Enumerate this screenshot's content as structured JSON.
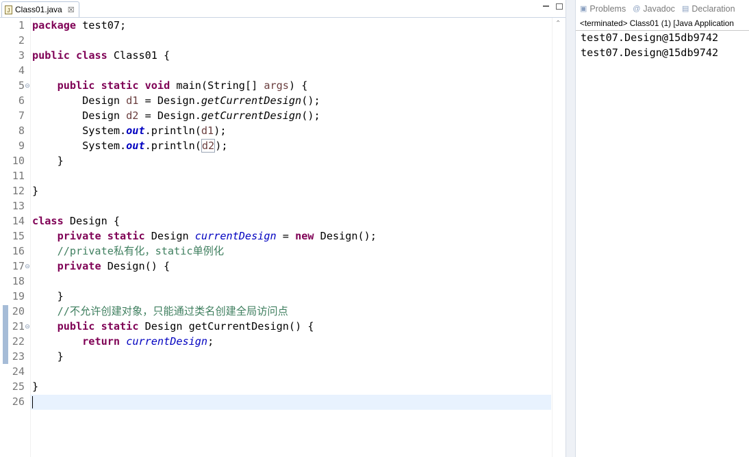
{
  "editor": {
    "tab_title": "Class01.java",
    "tab_close": "☒"
  },
  "lines": [
    {
      "n": "1",
      "tokens": [
        {
          "t": "package",
          "c": "kw"
        },
        {
          "t": " test07;"
        }
      ]
    },
    {
      "n": "2",
      "tokens": []
    },
    {
      "n": "3",
      "tokens": [
        {
          "t": "public",
          "c": "kw"
        },
        {
          "t": " "
        },
        {
          "t": "class",
          "c": "kw"
        },
        {
          "t": " Class01 {"
        }
      ]
    },
    {
      "n": "4",
      "tokens": []
    },
    {
      "n": "5",
      "fold": true,
      "tokens": [
        {
          "t": "    "
        },
        {
          "t": "public",
          "c": "kw"
        },
        {
          "t": " "
        },
        {
          "t": "static",
          "c": "kw"
        },
        {
          "t": " "
        },
        {
          "t": "void",
          "c": "kw"
        },
        {
          "t": " main(String[] "
        },
        {
          "t": "args",
          "c": "var"
        },
        {
          "t": ") {"
        }
      ]
    },
    {
      "n": "6",
      "tokens": [
        {
          "t": "        Design "
        },
        {
          "t": "d1",
          "c": "var"
        },
        {
          "t": " = Design."
        },
        {
          "t": "getCurrentDesign",
          "c": "sm"
        },
        {
          "t": "();"
        }
      ]
    },
    {
      "n": "7",
      "tokens": [
        {
          "t": "        Design "
        },
        {
          "t": "d2",
          "c": "var"
        },
        {
          "t": " = Design."
        },
        {
          "t": "getCurrentDesign",
          "c": "sm"
        },
        {
          "t": "();"
        }
      ]
    },
    {
      "n": "8",
      "tokens": [
        {
          "t": "        System."
        },
        {
          "t": "out",
          "c": "sfld"
        },
        {
          "t": ".println("
        },
        {
          "t": "d1",
          "c": "var"
        },
        {
          "t": ");"
        }
      ]
    },
    {
      "n": "9",
      "tokens": [
        {
          "t": "        System."
        },
        {
          "t": "out",
          "c": "sfld"
        },
        {
          "t": ".println("
        },
        {
          "t": "d2",
          "c": "var hlbox"
        },
        {
          "t": ");"
        }
      ]
    },
    {
      "n": "10",
      "tokens": [
        {
          "t": "    }"
        }
      ]
    },
    {
      "n": "11",
      "tokens": []
    },
    {
      "n": "12",
      "tokens": [
        {
          "t": "}"
        }
      ]
    },
    {
      "n": "13",
      "tokens": []
    },
    {
      "n": "14",
      "tokens": [
        {
          "t": "class",
          "c": "kw"
        },
        {
          "t": " Design {"
        }
      ]
    },
    {
      "n": "15",
      "tokens": [
        {
          "t": "    "
        },
        {
          "t": "private",
          "c": "kw"
        },
        {
          "t": " "
        },
        {
          "t": "static",
          "c": "kw"
        },
        {
          "t": " Design "
        },
        {
          "t": "currentDesign",
          "c": "fld"
        },
        {
          "t": " = "
        },
        {
          "t": "new",
          "c": "kw"
        },
        {
          "t": " Design();"
        }
      ]
    },
    {
      "n": "16",
      "tokens": [
        {
          "t": "    //private私有化，static单例化",
          "c": "cmt"
        }
      ]
    },
    {
      "n": "17",
      "fold": true,
      "tokens": [
        {
          "t": "    "
        },
        {
          "t": "private",
          "c": "kw"
        },
        {
          "t": " Design() {"
        }
      ]
    },
    {
      "n": "18",
      "tokens": []
    },
    {
      "n": "19",
      "tokens": [
        {
          "t": "    }"
        }
      ]
    },
    {
      "n": "20",
      "tokens": [
        {
          "t": "    //不允许创建对象，只能通过类名创建全局访问点",
          "c": "cmt"
        }
      ]
    },
    {
      "n": "21",
      "fold": true,
      "tokens": [
        {
          "t": "    "
        },
        {
          "t": "public",
          "c": "kw"
        },
        {
          "t": " "
        },
        {
          "t": "static",
          "c": "kw"
        },
        {
          "t": " Design getCurrentDesign() {"
        }
      ]
    },
    {
      "n": "22",
      "tokens": [
        {
          "t": "        "
        },
        {
          "t": "return",
          "c": "kw"
        },
        {
          "t": " "
        },
        {
          "t": "currentDesign",
          "c": "fld"
        },
        {
          "t": ";"
        }
      ]
    },
    {
      "n": "23",
      "tokens": [
        {
          "t": "    }"
        }
      ]
    },
    {
      "n": "24",
      "tokens": []
    },
    {
      "n": "25",
      "tokens": [
        {
          "t": "}"
        }
      ]
    },
    {
      "n": "26",
      "tokens": []
    }
  ],
  "console": {
    "tabs": [
      {
        "label": "Problems",
        "icon": "problems-icon"
      },
      {
        "label": "Javadoc",
        "icon": "javadoc-icon"
      },
      {
        "label": "Declaration",
        "icon": "declaration-icon"
      }
    ],
    "status": "<terminated> Class01 (1) [Java Application",
    "output": [
      "test07.Design@15db9742",
      "test07.Design@15db9742"
    ]
  }
}
